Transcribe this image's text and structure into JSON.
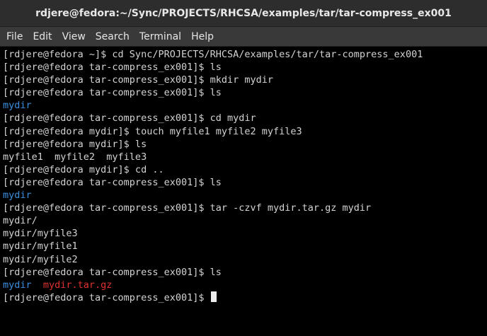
{
  "window": {
    "title": "rdjere@fedora:~/Sync/PROJECTS/RHCSA/examples/tar/tar-compress_ex001"
  },
  "menu": {
    "items": [
      "File",
      "Edit",
      "View",
      "Search",
      "Terminal",
      "Help"
    ]
  },
  "colors": {
    "directory": "#3a8ee0",
    "archive": "#e03030",
    "foreground": "#d3d3d3",
    "background": "#000000"
  },
  "terminal": {
    "lines": [
      "[rdjere@fedora ~]$ cd Sync/PROJECTS/RHCSA/examples/tar/tar-compress_ex001",
      "[rdjere@fedora tar-compress_ex001]$ ls",
      "[rdjere@fedora tar-compress_ex001]$ mkdir mydir",
      "[rdjere@fedora tar-compress_ex001]$ ls",
      "mydir",
      "[rdjere@fedora tar-compress_ex001]$ cd mydir",
      "[rdjere@fedora mydir]$ touch myfile1 myfile2 myfile3",
      "[rdjere@fedora mydir]$ ls",
      "myfile1  myfile2  myfile3",
      "[rdjere@fedora mydir]$ cd ..",
      "[rdjere@fedora tar-compress_ex001]$ ls",
      "mydir",
      "[rdjere@fedora tar-compress_ex001]$ tar -czvf mydir.tar.gz mydir",
      "mydir/",
      "mydir/myfile3",
      "mydir/myfile1",
      "mydir/myfile2",
      "[rdjere@fedora tar-compress_ex001]$ ls"
    ],
    "ls_output": {
      "dir": "mydir",
      "sep": "  ",
      "archive": "mydir.tar.gz"
    },
    "prompt": "[rdjere@fedora tar-compress_ex001]$ "
  }
}
